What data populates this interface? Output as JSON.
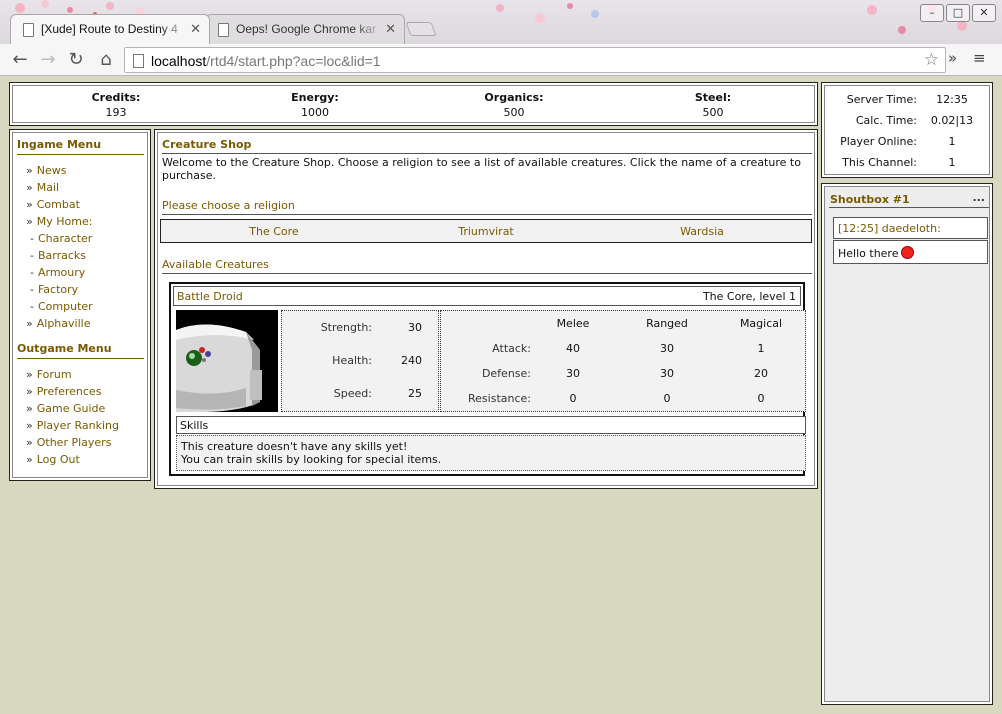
{
  "browser": {
    "tabs": [
      {
        "title": "[Xude] Route to Destiny 4",
        "active": true
      },
      {
        "title": "Oeps! Google Chrome kan",
        "active": false
      }
    ],
    "url_host": "localhost",
    "url_path": "/rtd4/start.php?ac=loc&lid=1"
  },
  "resources": [
    {
      "label": "Credits:",
      "value": "193"
    },
    {
      "label": "Energy:",
      "value": "1000"
    },
    {
      "label": "Organics:",
      "value": "500"
    },
    {
      "label": "Steel:",
      "value": "500"
    }
  ],
  "server_stats": [
    {
      "label": "Server Time:",
      "value": "12:35"
    },
    {
      "label": "Calc. Time:",
      "value": "0.02|13"
    },
    {
      "label": "Player Online:",
      "value": "1"
    },
    {
      "label": "This Channel:",
      "value": "1"
    }
  ],
  "ingame_menu": {
    "title": "Ingame Menu",
    "items": [
      "News",
      "Mail",
      "Combat",
      "My Home:"
    ],
    "sub_items": [
      "Character",
      "Barracks",
      "Armoury",
      "Factory",
      "Computer"
    ],
    "last_item": "Alphaville"
  },
  "outgame_menu": {
    "title": "Outgame Menu",
    "items": [
      "Forum",
      "Preferences",
      "Game Guide",
      "Player Ranking",
      "Other Players",
      "Log Out"
    ]
  },
  "shop": {
    "title": "Creature Shop",
    "welcome": "Welcome to the Creature Shop. Choose a religion to see a list of available creatures. Click the name of a creature to purchase.",
    "religion_heading": "Please choose a religion",
    "religions": [
      "The Core",
      "Triumvirat",
      "Wardsia"
    ],
    "creatures_heading": "Available Creatures"
  },
  "creature": {
    "name": "Battle Droid",
    "level": "The Core, level 1",
    "stats": [
      {
        "label": "Strength:",
        "value": "30"
      },
      {
        "label": "Health:",
        "value": "240"
      },
      {
        "label": "Speed:",
        "value": "25"
      }
    ],
    "combat_cols": [
      "Melee",
      "Ranged",
      "Magical"
    ],
    "combat_rows": [
      {
        "label": "Attack:",
        "values": [
          "40",
          "30",
          "1"
        ]
      },
      {
        "label": "Defense:",
        "values": [
          "30",
          "30",
          "20"
        ]
      },
      {
        "label": "Resistance:",
        "values": [
          "0",
          "0",
          "0"
        ]
      }
    ],
    "skills_title": "Skills",
    "skills_line1": "This creature doesn't have any skills yet!",
    "skills_line2": "You can train skills by looking for special items."
  },
  "shoutbox": {
    "title": "Shoutbox #1",
    "more": "...",
    "message_head": "[12:25] daedeloth:",
    "message_body": "Hello there"
  },
  "colors": {
    "link": "#7a5a00",
    "page_bg": "#d8d8c0",
    "box_bg": "#ffffff"
  }
}
